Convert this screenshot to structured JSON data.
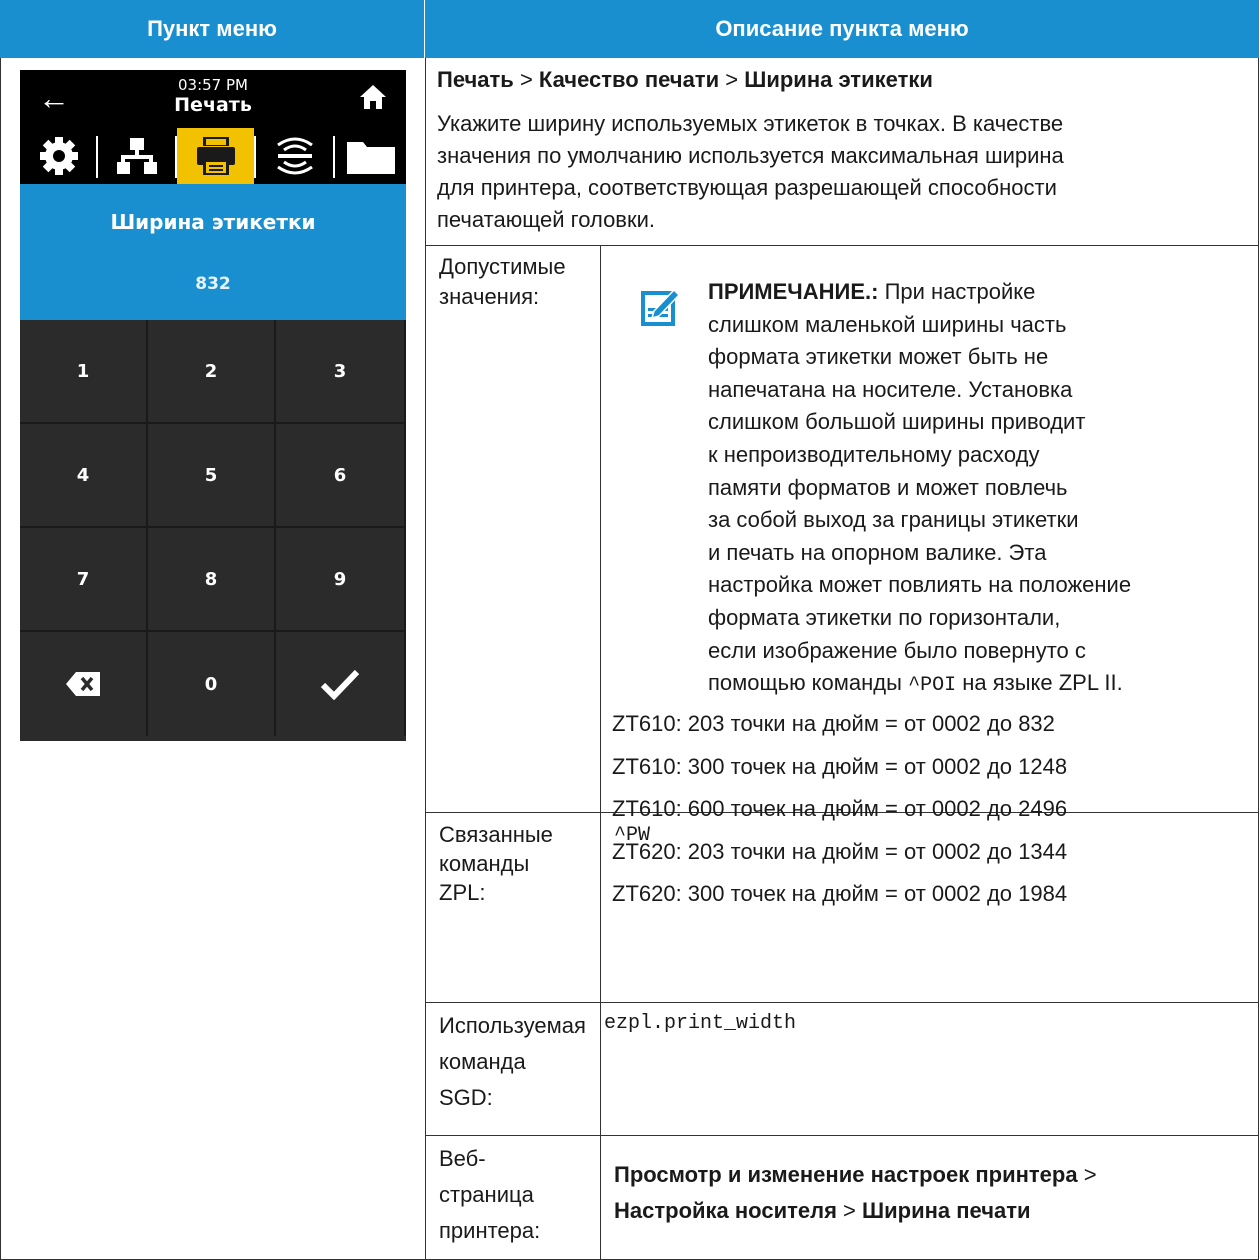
{
  "table": {
    "header_left": "Пункт меню",
    "header_right": "Описание пункта меню"
  },
  "printer_screen": {
    "time": "03:57 PM",
    "title": "Печать",
    "field_label": "Ширина этикетки",
    "value": "832",
    "keys": [
      "1",
      "2",
      "3",
      "4",
      "5",
      "6",
      "7",
      "8",
      "9",
      "0"
    ],
    "active_tab": "print"
  },
  "description": {
    "path_1": "Печать",
    "sep": ">",
    "path_2": "Качество печати",
    "path_3": "Ширина этикетки",
    "para_lines": [
      "Укажите ширину используемых этикеток в точках. В качестве",
      "значения по умолчанию используется максимальная ширина",
      "для принтера, соответствующая разрешающей способности",
      "печатающей головки."
    ]
  },
  "rows": {
    "accepted": {
      "label_lines": [
        "Допустимые",
        "значения:"
      ],
      "note_title": "ПРИМЕЧАНИЕ.:",
      "note_first": "При настройке",
      "note_lines": [
        "слишком маленькой ширины часть",
        "формата этикетки может быть не",
        "напечатана на носителе. Установка",
        "слишком большой ширины приводит",
        "к непроизводительному расходу",
        "памяти форматов и может повлечь",
        "за собой выход за границы этикетки",
        "и печать на опорном валике. Эта",
        "настройка может повлиять на положение",
        "формата этикетки по горизонтали,",
        "если изображение было повернуто с"
      ],
      "note_last_pre": "помощью команды",
      "note_last_code": "^POI",
      "note_last_post": "на языке ZPL II.",
      "values": [
        "ZT610: 203 точки на дюйм = от 0002 до 832",
        "ZT610: 300 точек на дюйм = от 0002 до 1248",
        "ZT610: 600 точек на дюйм = от 0002 до 2496",
        "ZT620: 203 точки на дюйм = от 0002 до 1344",
        "ZT620: 300 точек на дюйм = от 0002 до 1984"
      ]
    },
    "zpl": {
      "label_lines": [
        "Связанные",
        "команды",
        "ZPL:"
      ],
      "value": "^PW"
    },
    "sgd": {
      "label_lines": [
        "Используемая",
        "команда",
        "SGD:"
      ],
      "value": "ezpl.print_width"
    },
    "web": {
      "label_lines": [
        "Веб-",
        "страница",
        "принтера:"
      ],
      "path_1": "Просмотр и изменение настроек принтера",
      "sep": ">",
      "path_2": "Настройка носителя",
      "path_3": "Ширина печати"
    }
  }
}
